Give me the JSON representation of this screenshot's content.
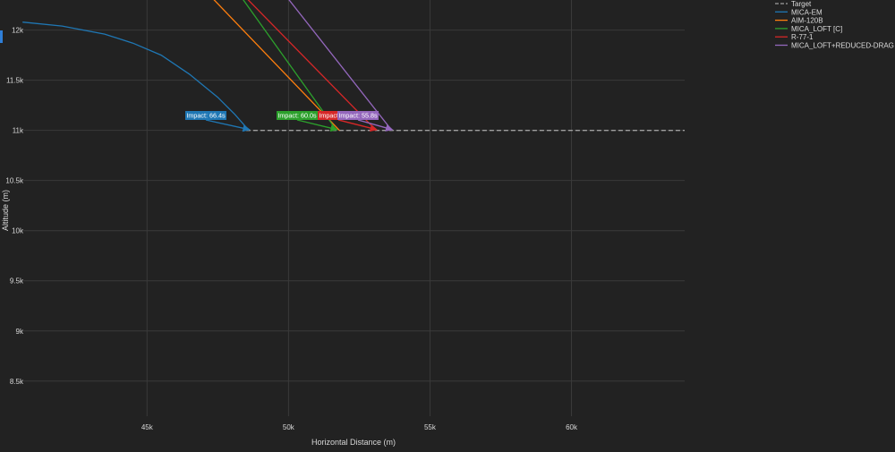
{
  "chart_data": {
    "type": "line",
    "title": "",
    "xlabel": "Horizontal Distance (m)",
    "ylabel": "Altitude (m)",
    "xlim": [
      40500,
      64000
    ],
    "ylim": [
      8150,
      12300
    ],
    "grid": true,
    "legend_position": "top-right",
    "x_ticks": [
      45000,
      50000,
      55000,
      60000
    ],
    "x_tick_labels": [
      "45k",
      "50k",
      "55k",
      "60k"
    ],
    "y_ticks": [
      8500,
      9000,
      9500,
      10000,
      10500,
      11000,
      11500,
      12000
    ],
    "y_tick_labels": [
      "8.5k",
      "9k",
      "9.5k",
      "10k",
      "10.5k",
      "11k",
      "11.5k",
      "12k"
    ],
    "series": [
      {
        "name": "Target",
        "color": "#a0a0a0",
        "dash": true,
        "x": [
          48500,
          64000
        ],
        "y": [
          11000,
          11000
        ]
      },
      {
        "name": "MICA-EM",
        "color": "#1f77b4",
        "x": [
          40600,
          42000,
          43500,
          44500,
          45500,
          46500,
          47500,
          48100,
          48600
        ],
        "y": [
          12080,
          12040,
          11960,
          11870,
          11750,
          11560,
          11330,
          11160,
          11000
        ]
      },
      {
        "name": "AIM-120B",
        "color": "#ff7f0e",
        "x": [
          47100,
          51800
        ],
        "y": [
          12380,
          11000
        ]
      },
      {
        "name": "MICA_LOFT [C]",
        "color": "#2ca02c",
        "x": [
          48200,
          51700
        ],
        "y": [
          12380,
          11000
        ]
      },
      {
        "name": "R-77-1",
        "color": "#d62728",
        "x": [
          48300,
          53100
        ],
        "y": [
          12380,
          11000
        ]
      },
      {
        "name": "MICA_LOFT+REDUCED-DRAG [C]",
        "color": "#9467bd",
        "x": [
          49800,
          53650
        ],
        "y": [
          12380,
          11000
        ]
      }
    ],
    "annotations": [
      {
        "text": "Impact: 66.4s",
        "color": "#1f77b4",
        "arrow_x": 48600,
        "arrow_y": 11000
      },
      {
        "text": "Impact: 60.0s",
        "color": "#2ca02c",
        "arrow_x": 51700,
        "arrow_y": 11000
      },
      {
        "text": "Impact: 58.3s",
        "color": "#d62728",
        "arrow_x": 53100,
        "arrow_y": 11000
      },
      {
        "text": "Impact: 55.8s",
        "color": "#9467bd",
        "arrow_x": 53650,
        "arrow_y": 11000
      }
    ]
  }
}
